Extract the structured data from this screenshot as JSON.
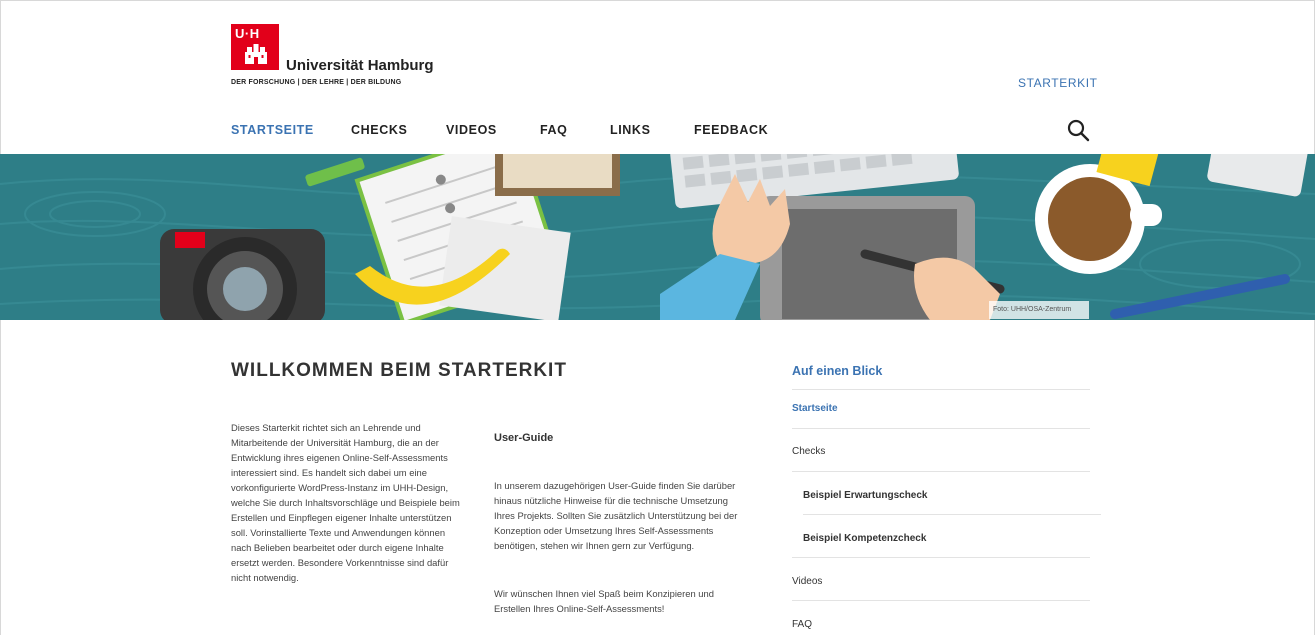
{
  "header": {
    "logo": {
      "mark": "U·H",
      "name": "Universität Hamburg",
      "tagline": "DER FORSCHUNG | DER LEHRE | DER BILDUNG",
      "icon": "castle-icon"
    },
    "starterkit_link": "STARTERKIT",
    "nav": [
      "STARTSEITE",
      "CHECKS",
      "VIDEOS",
      "FAQ",
      "LINKS",
      "FEEDBACK"
    ],
    "active_nav": "STARTSEITE",
    "search_icon": "search-icon"
  },
  "hero": {
    "credit": "Foto: UHH/OSA-Zentrum"
  },
  "main": {
    "title": "WILLKOMMEN BEIM STARTERKIT",
    "intro": "Dieses Starterkit richtet sich an Lehrende und Mitarbeitende der Universität Hamburg, die an der Entwicklung ihres eigenen Online-Self-Assessments interessiert sind. Es handelt sich dabei um eine vorkonfigurierte WordPress-Instanz im UHH-Design, welche Sie durch Inhaltsvorschläge und Beispiele beim Erstellen und Einpflegen eigener Inhalte unterstützen soll. Vorinstallierte Texte und Anwendungen können nach Belieben bearbeitet oder durch eigene Inhalte ersetzt werden.  Besondere Vorkenntnisse sind dafür nicht notwendig.",
    "user_guide": {
      "title": "User-Guide",
      "p1": "In unserem dazugehörigen User-Guide finden Sie darüber hinaus nützliche Hinweise für die technische Umsetzung Ihres Projekts. Sollten Sie zusätzlich Unterstützung bei der Konzeption oder Umsetzung Ihres Self-Assessments benötigen, stehen wir Ihnen gern zur Verfügung.",
      "p2": "Wir wünschen Ihnen viel Spaß beim Konzipieren und Erstellen Ihres Online-Self-Assessments!"
    }
  },
  "sidebar": {
    "title": "Auf einen Blick",
    "items": [
      {
        "label": "Startseite",
        "active": true
      },
      {
        "label": "Checks"
      },
      {
        "label": "Beispiel Erwartungscheck"
      },
      {
        "label": "Beispiel Kompetenzcheck"
      },
      {
        "label": "Videos"
      },
      {
        "label": "FAQ"
      }
    ]
  },
  "colors": {
    "accent": "#3b73b2",
    "brand_red": "#e2001a",
    "hero_bg": "#2e7e87"
  }
}
